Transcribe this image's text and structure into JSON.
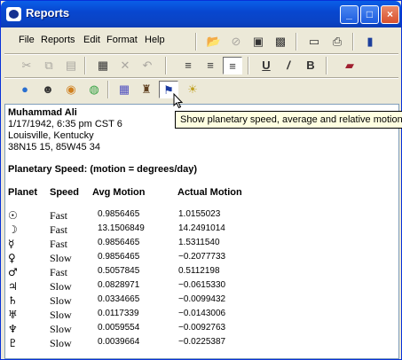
{
  "window": {
    "title": "Reports",
    "min_glyph": "_",
    "max_glyph": "□",
    "close_glyph": "×"
  },
  "menu": [
    "File",
    "Reports",
    "Edit",
    "Format",
    "Help"
  ],
  "toolbar": {
    "tooltip": "Show planetary speed, average and relative motion"
  },
  "report": {
    "name": "Muhammad Ali",
    "date": "1/17/1942, 6:35 pm CST 6",
    "place": "Louisville, Kentucky",
    "coords": "38N15 15, 85W45 34",
    "heading": "Planetary Speed: (motion = degrees/day)",
    "columns": [
      "Planet",
      "Speed",
      "Avg Motion",
      "Actual Motion"
    ],
    "rows": [
      {
        "glyph": "☉",
        "speed": "Fast",
        "avg": "0.9856465",
        "actual": "1.0155023"
      },
      {
        "glyph": "☽",
        "speed": "Fast",
        "avg": "13.1506849",
        "actual": "14.2491014"
      },
      {
        "glyph": "☿",
        "speed": "Fast",
        "avg": "0.9856465",
        "actual": "1.5311540"
      },
      {
        "glyph": "♀",
        "speed": "Slow",
        "avg": "0.9856465",
        "actual": "−0.2077733"
      },
      {
        "glyph": "♂",
        "speed": "Fast",
        "avg": "0.5057845",
        "actual": "0.5112198"
      },
      {
        "glyph": "♃",
        "speed": "Slow",
        "avg": "0.0828971",
        "actual": "−0.0615330"
      },
      {
        "glyph": "♄",
        "speed": "Slow",
        "avg": "0.0334665",
        "actual": "−0.0099432"
      },
      {
        "glyph": "♅",
        "speed": "Slow",
        "avg": "0.0117339",
        "actual": "−0.0143006"
      },
      {
        "glyph": "♆",
        "speed": "Slow",
        "avg": "0.0059554",
        "actual": "−0.0092763"
      },
      {
        "glyph": "♇",
        "speed": "Slow",
        "avg": "0.0039664",
        "actual": "−0.0225387"
      }
    ]
  }
}
